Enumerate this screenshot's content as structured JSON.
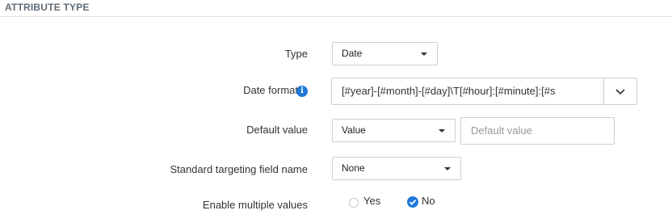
{
  "section": {
    "title": "ATTRIBUTE TYPE"
  },
  "form": {
    "type": {
      "label": "Type",
      "value": "Date"
    },
    "date_format": {
      "label": "Date format",
      "info_icon": "info-icon",
      "value": "[#year]-[#month]-[#day]\\T[#hour]:[#minute]:[#s"
    },
    "default_value": {
      "label": "Default value",
      "mode_value": "Value",
      "placeholder": "Default value"
    },
    "standard_targeting": {
      "label": "Standard targeting field name",
      "value": "None"
    },
    "enable_multiple": {
      "label": "Enable multiple values",
      "options": [
        "Yes",
        "No"
      ],
      "selected": "No"
    }
  },
  "colors": {
    "accent": "#1e78d7",
    "border": "#cfcfcf",
    "section_title": "#5f6b76"
  }
}
